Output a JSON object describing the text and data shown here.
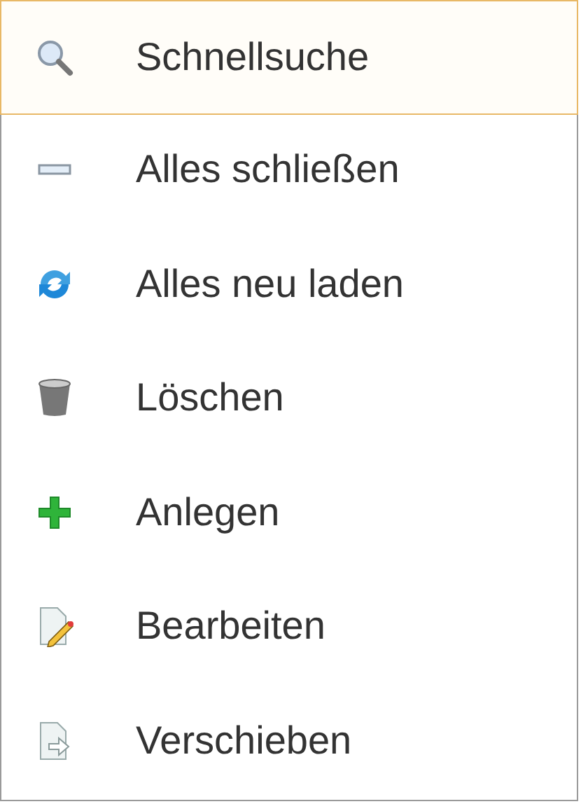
{
  "menu": {
    "items": [
      {
        "kind": "search",
        "label": "Schnellsuche",
        "selected": true
      },
      {
        "kind": "collapse",
        "label": "Alles schließen",
        "selected": false
      },
      {
        "kind": "reload",
        "label": "Alles neu laden",
        "selected": false
      },
      {
        "kind": "delete",
        "label": "Löschen",
        "selected": false
      },
      {
        "kind": "add",
        "label": "Anlegen",
        "selected": false
      },
      {
        "kind": "edit",
        "label": "Bearbeiten",
        "selected": false
      },
      {
        "kind": "move",
        "label": "Verschieben",
        "selected": false
      }
    ]
  }
}
